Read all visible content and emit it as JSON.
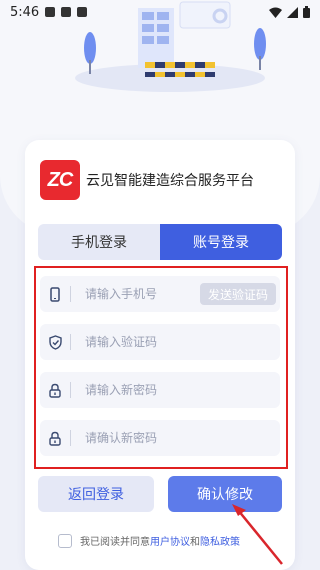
{
  "status_bar": {
    "time": "5:46"
  },
  "brand": {
    "logo_text": "ZC",
    "name": "云见智能建造综合服务平台"
  },
  "tabs": [
    {
      "label": "手机登录",
      "active": false
    },
    {
      "label": "账号登录",
      "active": true
    }
  ],
  "form": {
    "phone": {
      "placeholder": "请输入手机号",
      "value": ""
    },
    "send_code_label": "发送验证码",
    "code": {
      "placeholder": "请输入验证码",
      "value": ""
    },
    "new_password": {
      "placeholder": "请输入新密码",
      "value": ""
    },
    "confirm_password": {
      "placeholder": "请确认新密码",
      "value": ""
    }
  },
  "buttons": {
    "back": "返回登录",
    "confirm": "确认修改"
  },
  "agreement": {
    "prefix": "我已阅读并同意",
    "user_agreement": "用户协议",
    "and": "和",
    "privacy_policy": "隐私政策"
  },
  "colors": {
    "primary": "#3f5fe0",
    "accent_red": "#e02020",
    "logo_red": "#e8292f"
  }
}
